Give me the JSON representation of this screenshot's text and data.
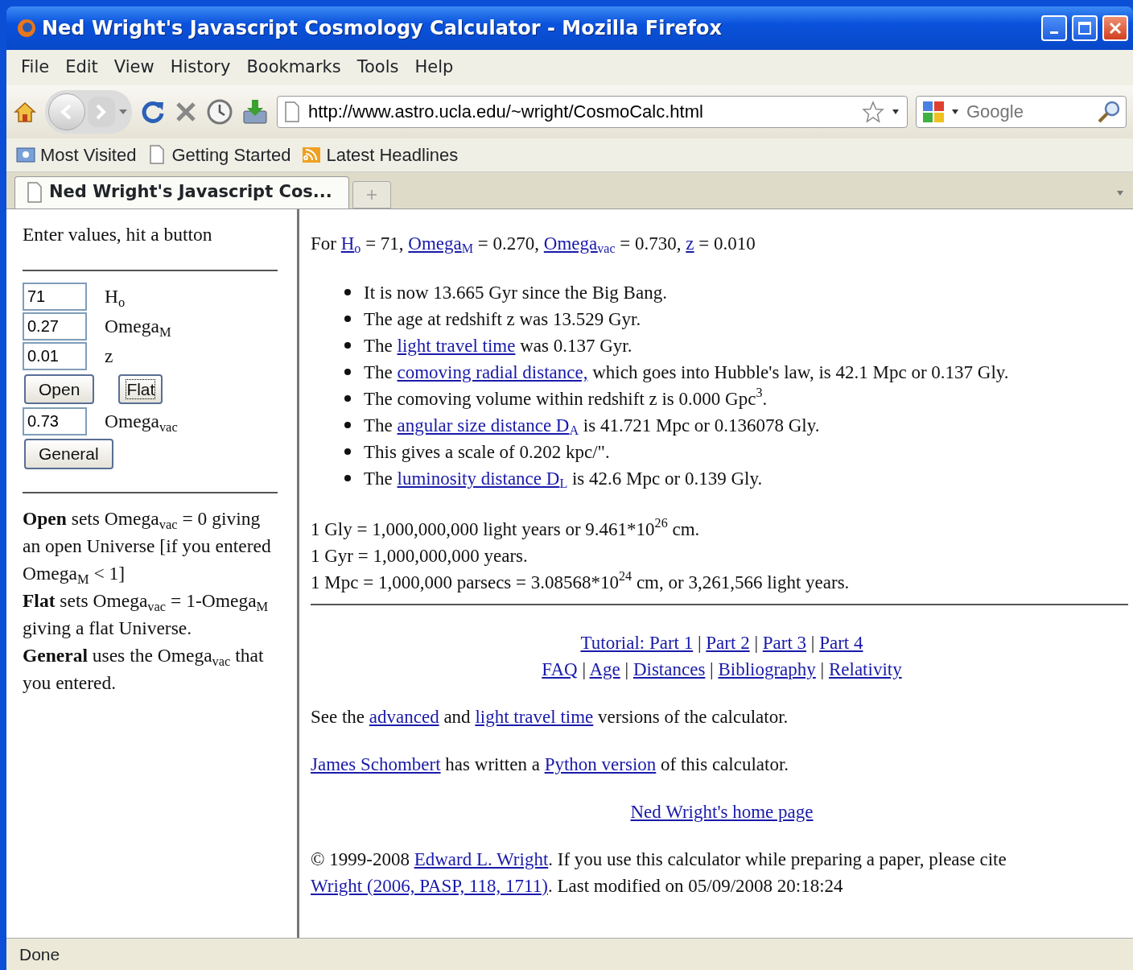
{
  "window": {
    "title": "Ned Wright's Javascript Cosmology Calculator - Mozilla Firefox"
  },
  "menu": [
    {
      "label": "File"
    },
    {
      "label": "Edit"
    },
    {
      "label": "View"
    },
    {
      "label": "History"
    },
    {
      "label": "Bookmarks"
    },
    {
      "label": "Tools"
    },
    {
      "label": "Help"
    }
  ],
  "address_bar": {
    "url": "http://www.astro.ucla.edu/~wright/CosmoCalc.html"
  },
  "search": {
    "placeholder": "Google"
  },
  "bookmarks": [
    {
      "label": "Most Visited",
      "kind": "folder"
    },
    {
      "label": "Getting Started",
      "kind": "page"
    },
    {
      "label": "Latest Headlines",
      "kind": "feed"
    }
  ],
  "tabs": [
    {
      "label": "Ned Wright's Javascript Cos...",
      "selected": true
    }
  ],
  "sidebar": {
    "intro": "Enter values, hit a button",
    "form": [
      {
        "kind": "field",
        "value": "71",
        "label": "H$_{o}$"
      },
      {
        "kind": "field",
        "value": "0.27",
        "label": "Omega$_{M}$"
      },
      {
        "kind": "field",
        "value": "0.01",
        "label": "z"
      },
      {
        "kind": "buttons",
        "buttons": [
          {
            "label": "Open",
            "focused": false
          },
          {
            "label": "Flat",
            "focused": true
          }
        ]
      },
      {
        "kind": "field",
        "value": "0.73",
        "label": "Omega$_{vac}$"
      },
      {
        "kind": "buttons",
        "buttons": [
          {
            "label": "General",
            "focused": false
          }
        ]
      }
    ],
    "help": [
      "**Open** sets Omega$_{vac}$ = 0 giving an open Universe [if you entered Omega$_{M}$ < 1]",
      "**Flat** sets Omega$_{vac}$ = 1-Omega$_{M}$ giving a flat Universe.",
      "**General** uses the Omega$_{vac}$ that you entered."
    ]
  },
  "main": {
    "header": [
      {
        "t": "For "
      },
      {
        "t": "H$_{o}$",
        "link": true
      },
      {
        "t": " = 71, "
      },
      {
        "t": "Omega$_{M}$",
        "link": true
      },
      {
        "t": " = 0.270, "
      },
      {
        "t": "Omega$_{vac}$",
        "link": true
      },
      {
        "t": " = 0.730, "
      },
      {
        "t": "z",
        "link": true
      },
      {
        "t": " = 0.010"
      }
    ],
    "results": [
      [
        {
          "t": "It is now 13.665 Gyr since the Big Bang."
        }
      ],
      [
        {
          "t": "The age at redshift z was 13.529 Gyr."
        }
      ],
      [
        {
          "t": "The "
        },
        {
          "t": "light travel time",
          "link": true
        },
        {
          "t": " was 0.137 Gyr."
        }
      ],
      [
        {
          "t": "The "
        },
        {
          "t": "comoving radial distance,",
          "link": true
        },
        {
          "t": " which goes into Hubble's law, is 42.1 Mpc or 0.137 Gly."
        }
      ],
      [
        {
          "t": "The comoving volume within redshift z is 0.000 Gpc$^{3}$."
        }
      ],
      [
        {
          "t": "The "
        },
        {
          "t": "angular size distance D$_{A}$",
          "link": true
        },
        {
          "t": " is 41.721 Mpc or 0.136078 Gly."
        }
      ],
      [
        {
          "t": "This gives a scale of 0.202 kpc/\"."
        }
      ],
      [
        {
          "t": "The "
        },
        {
          "t": "luminosity distance D$_{L}$",
          "link": true
        },
        {
          "t": " is 42.6 Mpc or 0.139 Gly."
        }
      ]
    ],
    "units": [
      "1 Gly = 1,000,000,000 light years or 9.461*10$^{26}$ cm.",
      "1 Gyr = 1,000,000,000 years.",
      "1 Mpc = 1,000,000 parsecs = 3.08568*10$^{24}$ cm, or 3,261,566 light years."
    ],
    "nav_rows": [
      {
        "separator": "|",
        "links": [
          "Tutorial: Part 1",
          "Part 2",
          "Part 3",
          "Part 4"
        ]
      },
      {
        "separator": "|",
        "links": [
          "FAQ",
          "Age",
          "Distances",
          "Bibliography",
          "Relativity"
        ]
      }
    ],
    "paragraphs": [
      {
        "segments": [
          {
            "t": "See the "
          },
          {
            "t": "advanced",
            "link": true
          },
          {
            "t": " and "
          },
          {
            "t": "light travel time",
            "link": true
          },
          {
            "t": " versions of the calculator."
          }
        ]
      },
      {
        "segments": [
          {
            "t": "James Schombert",
            "link": true
          },
          {
            "t": " has written a "
          },
          {
            "t": "Python version",
            "link": true
          },
          {
            "t": " of this calculator."
          }
        ]
      },
      {
        "home_link": "Ned Wright's home page"
      },
      {
        "segments": [
          {
            "t": "© 1999-2008 "
          },
          {
            "t": "Edward L. Wright",
            "link": true
          },
          {
            "t": ". If you use this calculator while preparing a paper, please cite "
          },
          {
            "t": "Wright (2006, PASP, 118, 1711)",
            "link": true
          },
          {
            "t": ". Last modified on 05/09/2008 20:18:24"
          }
        ]
      }
    ]
  },
  "status_bar": {
    "text": "Done"
  }
}
